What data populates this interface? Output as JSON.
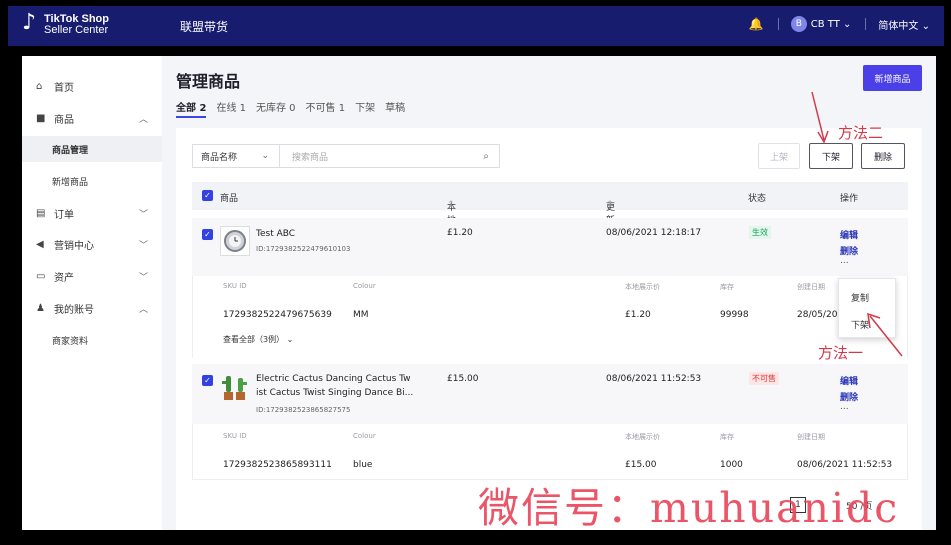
{
  "header": {
    "logo_line1": "TikTok Shop",
    "logo_line2": "Seller Center",
    "title": "联盟带货",
    "user": "CB TT",
    "language": "简体中文"
  },
  "sidebar": {
    "items": [
      {
        "label": "首页",
        "icon": "home-icon"
      },
      {
        "label": "商品",
        "icon": "product-icon"
      },
      {
        "label": "商品管理"
      },
      {
        "label": "新增商品"
      },
      {
        "label": "订单",
        "icon": "order-icon"
      },
      {
        "label": "营销中心",
        "icon": "megaphone-icon"
      },
      {
        "label": "资产",
        "icon": "card-icon"
      },
      {
        "label": "我的账号",
        "icon": "user-icon"
      },
      {
        "label": "商家资料"
      }
    ]
  },
  "main": {
    "title": "管理商品",
    "add_button": "新增商品",
    "tabs": [
      {
        "label": "全部 2"
      },
      {
        "label": "在线 1"
      },
      {
        "label": "无库存 0"
      },
      {
        "label": "不可售 1"
      },
      {
        "label": "下架"
      },
      {
        "label": "草稿"
      }
    ],
    "filter_select": "商品名称",
    "search_placeholder": "搜索商品",
    "btn_list": "上架",
    "btn_delist": "下架",
    "btn_delete": "删除"
  },
  "table": {
    "headers": {
      "product": "商品",
      "price": "本地展示价",
      "updated": "更新时间",
      "status": "状态",
      "actions": "操作"
    },
    "products": [
      {
        "name": "Test ABC",
        "name2": "",
        "id": "ID:1729382522479610103",
        "price": "£1.20",
        "updated": "08/06/2021 12:18:17",
        "status": "生效",
        "edit": "编辑",
        "delete": "删除",
        "more": "...",
        "sku": {
          "labels": {
            "sku_id": "SKU ID",
            "colour": "Colour",
            "price": "本地展示价",
            "stock": "库存",
            "created": "创建日期"
          },
          "sku_id": "1729382522479675639",
          "colour": "MM",
          "price": "£1.20",
          "stock": "99998",
          "created": "28/05/20"
        },
        "view_all": "查看全部（3例）"
      },
      {
        "name": "Electric Cactus Dancing Cactus Tw",
        "name2": "ist Cactus Twist Singing Dance Bi...",
        "id": "ID:1729382523865827575",
        "price": "£15.00",
        "updated": "08/06/2021 11:52:53",
        "status": "不可售",
        "edit": "编辑",
        "delete": "删除",
        "more": "...",
        "sku": {
          "labels": {
            "sku_id": "SKU ID",
            "colour": "Colour",
            "price": "本地展示价",
            "stock": "库存",
            "created": "创建日期"
          },
          "sku_id": "1729382523865893111",
          "colour": "blue",
          "price": "£15.00",
          "stock": "1000",
          "created": "08/06/2021 11:52:53"
        }
      }
    ]
  },
  "popup": {
    "copy": "复制",
    "delist": "下架"
  },
  "annotations": {
    "method2": "方法二",
    "method1": "方法一"
  },
  "pager": {
    "page": "1",
    "per_page": "50 /页"
  },
  "watermark": "微信号：muhuanidc"
}
